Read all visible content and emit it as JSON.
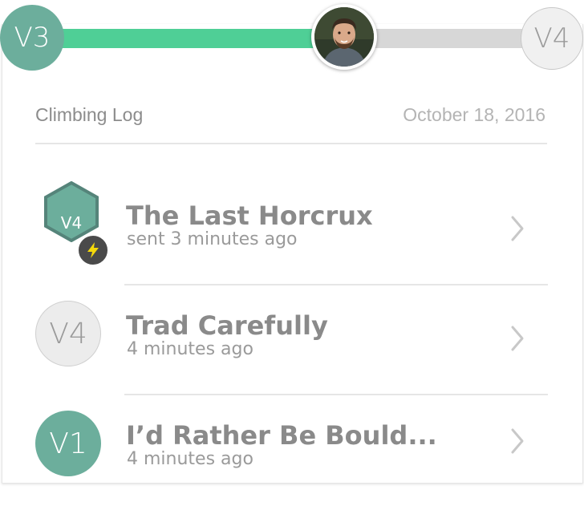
{
  "progress": {
    "start_level": "V3",
    "end_level": "V4",
    "fill_fraction": 0.55,
    "colors": {
      "fill": "#4fcf96",
      "track": "#d7d7d7",
      "start_circle": "#6cae9c"
    }
  },
  "header": {
    "title": "Climbing Log",
    "date": "October 18, 2016"
  },
  "routes": [
    {
      "grade": "V4",
      "name": "The Last Horcrux",
      "status": "sent 3 minutes ago",
      "badge": "hexagon",
      "icon": "lightning-bolt-icon"
    },
    {
      "grade": "V4",
      "name": "Trad Carefully",
      "status": "4 minutes ago",
      "badge": "circle-grey"
    },
    {
      "grade": "V1",
      "name": "I’d Rather Be Bould...",
      "status": "4 minutes ago",
      "badge": "circle-green"
    }
  ]
}
